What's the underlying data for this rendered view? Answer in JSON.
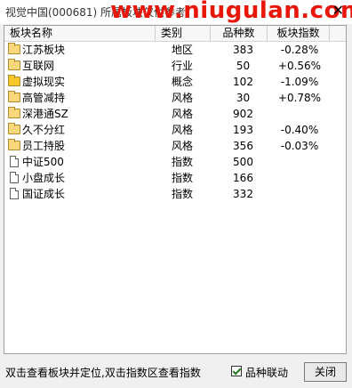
{
  "window": {
    "title": "视觉中国(000681) 所属板块仅供参考",
    "watermark": "www.niugulan.com",
    "close_glyph": "✕"
  },
  "table": {
    "headers": [
      "板块名称",
      "类别",
      "品种数",
      "板块指数"
    ],
    "rows": [
      {
        "icon": "folder",
        "name": "江苏板块",
        "type": "地区",
        "count": "383",
        "index": "-0.28%"
      },
      {
        "icon": "folder",
        "name": "互联网",
        "type": "行业",
        "count": "50",
        "index": "+0.56%"
      },
      {
        "icon": "folder-yellow",
        "name": "虚拟现实",
        "type": "概念",
        "count": "102",
        "index": "-1.09%"
      },
      {
        "icon": "folder",
        "name": "高管减持",
        "type": "风格",
        "count": "30",
        "index": "+0.78%"
      },
      {
        "icon": "folder",
        "name": "深港通SZ",
        "type": "风格",
        "count": "902",
        "index": ""
      },
      {
        "icon": "folder",
        "name": "久不分红",
        "type": "风格",
        "count": "193",
        "index": "-0.40%"
      },
      {
        "icon": "folder",
        "name": "员工持股",
        "type": "风格",
        "count": "356",
        "index": "-0.03%"
      },
      {
        "icon": "doc",
        "name": "中证500",
        "type": "指数",
        "count": "500",
        "index": ""
      },
      {
        "icon": "doc",
        "name": "小盘成长",
        "type": "指数",
        "count": "166",
        "index": ""
      },
      {
        "icon": "doc",
        "name": "国证成长",
        "type": "指数",
        "count": "332",
        "index": ""
      }
    ]
  },
  "footer": {
    "status_text": "双击查看板块并定位,双击指数区查看指数",
    "checkbox_label": "品种联动",
    "checkbox_checked": true,
    "close_button": "关闭"
  },
  "colors": {
    "watermark": "#e8170a",
    "background": "#f0f0f0",
    "panel": "#ffffff"
  }
}
